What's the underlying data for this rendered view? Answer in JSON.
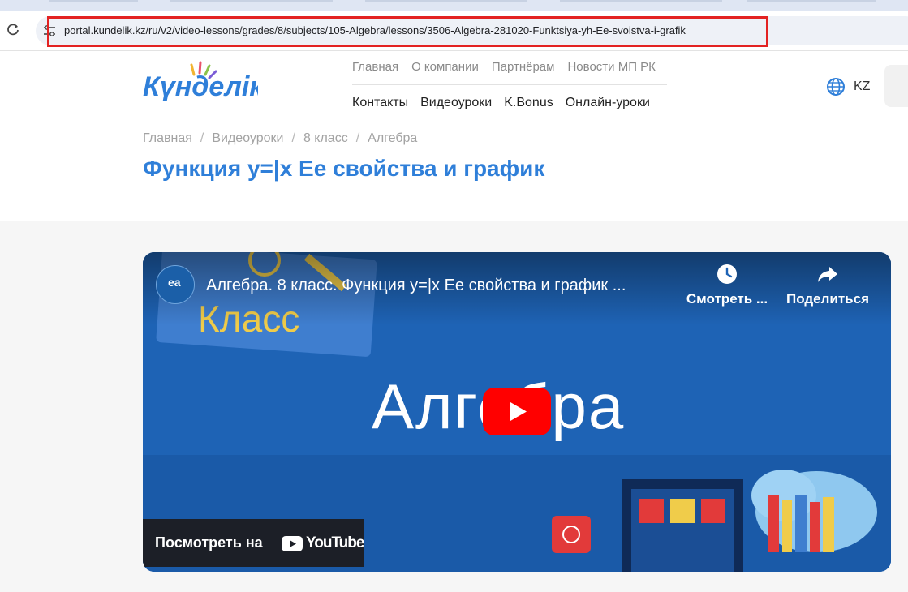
{
  "browser": {
    "url": "portal.kundelik.kz/ru/v2/video-lessons/grades/8/subjects/105-Algebra/lessons/3506-Algebra-281020-Funktsiya-yh-Ee-svoistva-i-grafik"
  },
  "header": {
    "logo_text": "Күнделік",
    "nav_top": [
      "Главная",
      "О компании",
      "Партнёрам",
      "Новости МП РК"
    ],
    "nav_main": [
      "Контакты",
      "Видеоуроки",
      "K.Bonus",
      "Онлайн-уроки"
    ],
    "language": "KZ"
  },
  "breadcrumb": [
    "Главная",
    "Видеоуроки",
    "8 класс",
    "Алгебра"
  ],
  "breadcrumb_sep": "/",
  "page_title": "Функция y=|x Ее свойства и график",
  "video": {
    "title": "Алгебра. 8 класс. Функция y=|x Ее свойства и график ...",
    "watch_later_label": "Смотреть ...",
    "share_label": "Поделиться",
    "thumb_word_top": "Класс",
    "thumb_word_main": "Алгебра",
    "watch_on_label": "Посмотреть на",
    "youtube_word": "YouTube",
    "channel_badge": "ea"
  },
  "colors": {
    "accent": "#2f7fd9",
    "highlight_border": "#e32222",
    "youtube_red": "#ff0000",
    "video_bg": "#1e63b5"
  }
}
